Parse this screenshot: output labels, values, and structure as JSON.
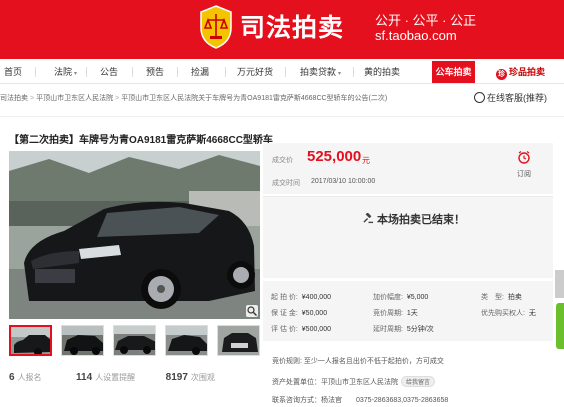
{
  "header": {
    "brand_title": "司法拍卖",
    "slogan": "公开 · 公平 · 公正",
    "domain": "sf.taobao.com"
  },
  "nav": {
    "items": [
      {
        "label": "首页",
        "dropdown": false
      },
      {
        "label": "法院",
        "dropdown": true
      },
      {
        "label": "公告",
        "dropdown": false
      },
      {
        "label": "预告",
        "dropdown": false
      },
      {
        "label": "捡漏",
        "dropdown": false
      },
      {
        "label": "万元好货",
        "dropdown": false
      },
      {
        "label": "拍卖贷款",
        "dropdown": true
      },
      {
        "label": "黄的拍卖",
        "dropdown": false
      }
    ],
    "car_auction": "公车拍卖",
    "treasure_auction": "珍品拍卖"
  },
  "breadcrumb": {
    "items": [
      "司法拍卖",
      "平顶山市卫东区人民法院",
      "平顶山市卫东区人民法院关于车牌号为青OA9181雷克萨斯4668CC型轿车的公告(二次)"
    ]
  },
  "service": {
    "label": "在线客服(推荐)"
  },
  "lot": {
    "title": "【第二次拍卖】车牌号为青OA9181雷克萨斯4668CC型轿车",
    "thumbnail_count": 5,
    "stats": {
      "signups": "6",
      "signups_label": "人报名",
      "reminders": "114",
      "reminders_label": "人设置提醒",
      "views": "8197",
      "views_label": "次围观"
    }
  },
  "price": {
    "deal_label": "成交价",
    "deal_price": "525,000",
    "deal_unit": "元",
    "time_label": "成交时间",
    "deal_time": "2017/03/10 10:00:00",
    "remind_label": "订阅"
  },
  "status": {
    "ended_text": "本场拍卖已结束！"
  },
  "details": {
    "start_price_label": "起 拍 价",
    "start_price": "¥400,000",
    "increment_label": "加价幅度",
    "increment": "¥5,000",
    "deposit_label": "保 证 金",
    "deposit": "¥50,000",
    "cycle_label": "竞价周期",
    "cycle": "1天",
    "assessment_label": "评 估 价",
    "assessment": "¥500,000",
    "delay_label": "延时周期",
    "delay": "5分钟/次",
    "type_label": "类　型",
    "type": "拍卖",
    "priority_label": "优先购买权人",
    "priority": "无"
  },
  "notes": {
    "rule_label": "竞价规则:",
    "rule": "至少一人报名且出价不低于起拍价，方可成交",
    "disposer_label": "资产处置单位：",
    "disposer": "平顶山市卫东区人民法院",
    "disposer_tag": "给我留言",
    "contact_label": "联系咨询方式：",
    "contact_person": "杨法官",
    "contact_phone": "0375-2863683,0375-2863658"
  },
  "colors": {
    "brand_red": "#e4101e",
    "price_red": "#e4101e",
    "panel_bg": "#f5f5f5"
  }
}
